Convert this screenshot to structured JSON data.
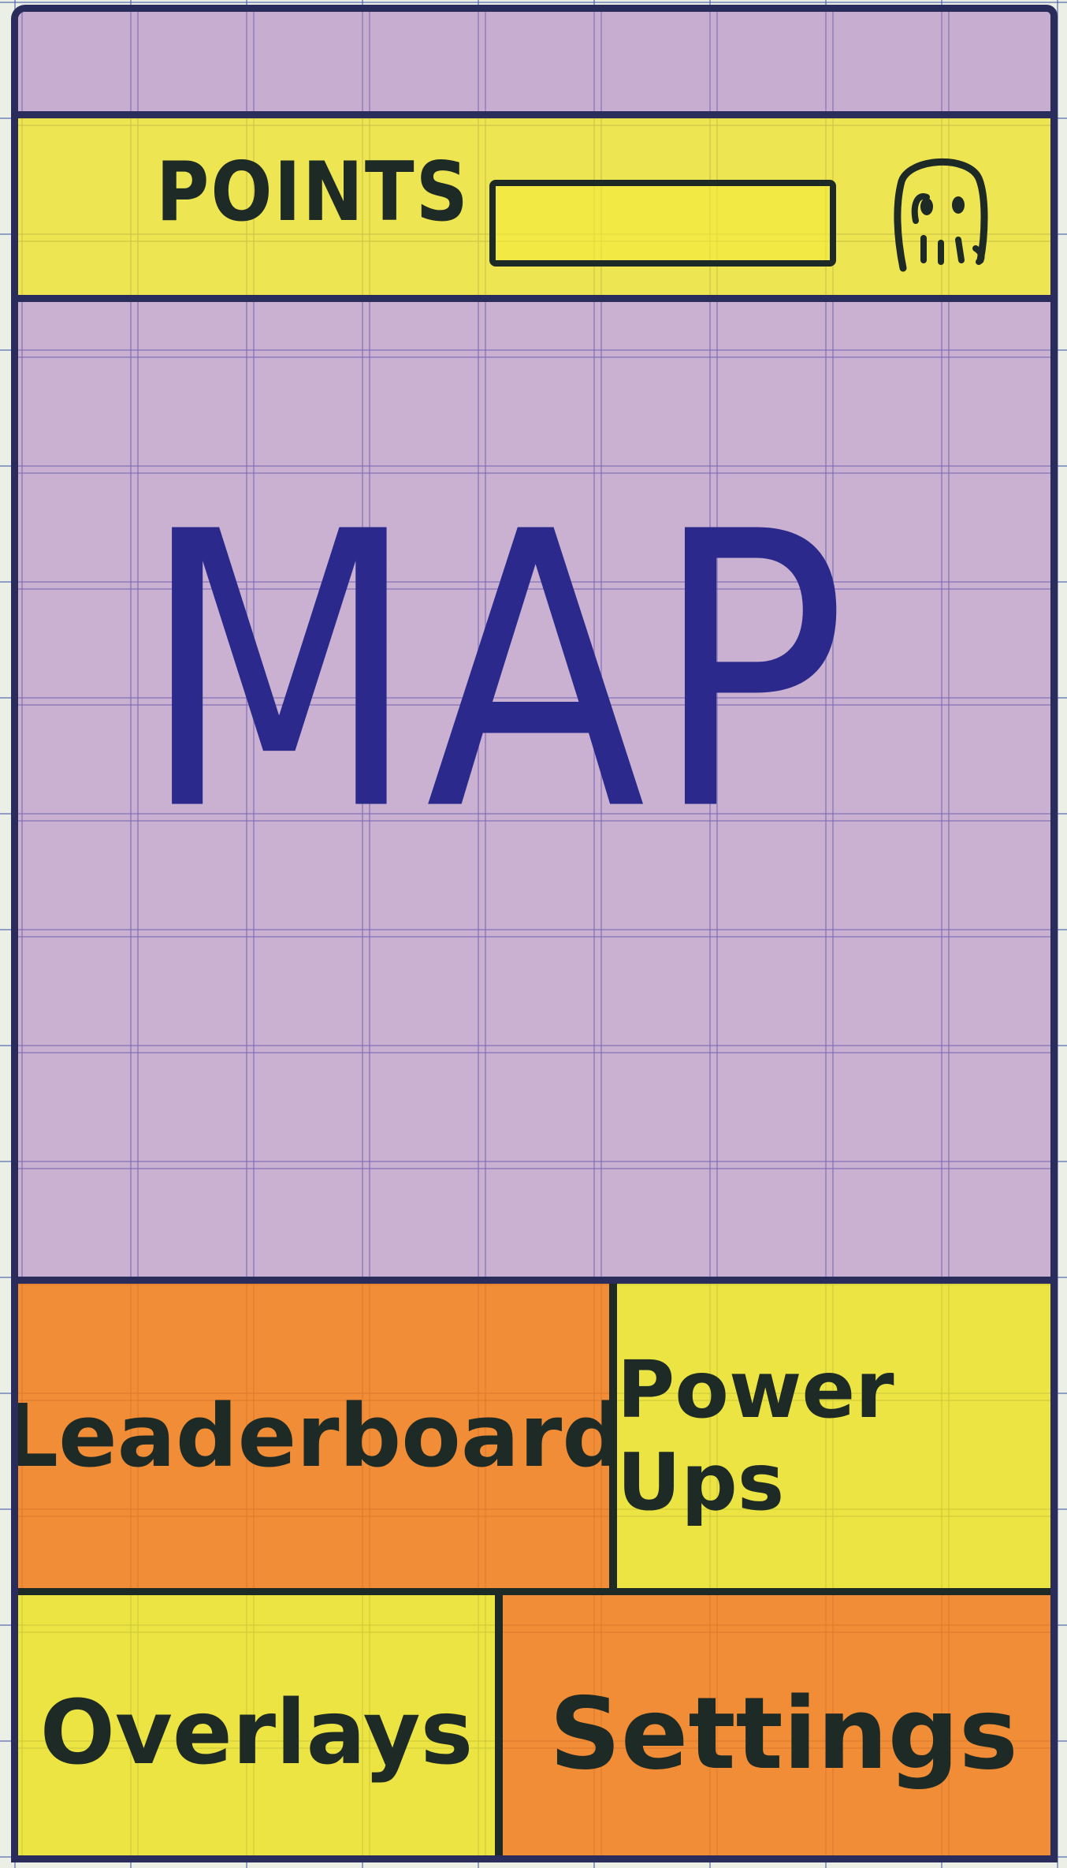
{
  "status_bar": {
    "color": "#b58bc7"
  },
  "top_bar": {
    "points_label": "POINTS",
    "points_progress": 0,
    "avatar_icon": "ghost-icon",
    "color": "#eee228"
  },
  "map": {
    "label": "MAP",
    "color": "#b58bc7"
  },
  "nav": {
    "leaderboard_label": "Leaderboard",
    "powerups_label": "Power Ups",
    "overlays_label": "Overlays",
    "settings_label": "Settings"
  },
  "colors": {
    "outline": "#2a2d5c",
    "orange": "#f0801e",
    "yellow": "#ece21e",
    "purple": "#b58bc7"
  }
}
